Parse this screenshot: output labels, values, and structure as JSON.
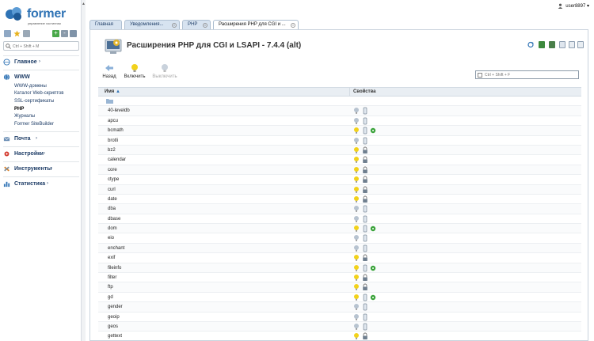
{
  "brand": {
    "name": "former",
    "subtitle": "управление хостингом"
  },
  "user": {
    "name": "user8897"
  },
  "sidebar": {
    "search_placeholder": "Ctrl + Shift + M",
    "groups": [
      {
        "label": "Главное"
      },
      {
        "label": "WWW"
      },
      {
        "label": "Почта"
      },
      {
        "label": "Настройки"
      },
      {
        "label": "Инструменты"
      },
      {
        "label": "Статистика"
      }
    ],
    "www_items": [
      "WWW-домены",
      "Каталог Web-скриптов",
      "SSL-сертификаты",
      "PHP",
      "Журналы",
      "Former SiteBuilder"
    ]
  },
  "tabs": [
    {
      "label": "Главная"
    },
    {
      "label": "Уведомления..."
    },
    {
      "label": "PHP"
    },
    {
      "label": "Расширения PHP для CGI и ..."
    }
  ],
  "page": {
    "title": "Расширения PHP для CGI и LSAPI - 7.4.4 (alt)"
  },
  "toolbar": {
    "back": "Назад",
    "enable": "Включить",
    "disable": "Выключить"
  },
  "filter": {
    "placeholder": "Ctrl + Shift + F"
  },
  "table": {
    "col_name": "Имя",
    "col_props": "Свойства",
    "rows": [
      {
        "name": "40-leveldb",
        "on": false,
        "lock": false,
        "ext": false
      },
      {
        "name": "apcu",
        "on": false,
        "lock": false,
        "ext": false
      },
      {
        "name": "bcmath",
        "on": true,
        "lock": false,
        "ext": true
      },
      {
        "name": "brotli",
        "on": false,
        "lock": false,
        "ext": false
      },
      {
        "name": "bz2",
        "on": true,
        "lock": true,
        "ext": false
      },
      {
        "name": "calendar",
        "on": true,
        "lock": true,
        "ext": false
      },
      {
        "name": "core",
        "on": true,
        "lock": true,
        "ext": false
      },
      {
        "name": "ctype",
        "on": true,
        "lock": true,
        "ext": false
      },
      {
        "name": "curl",
        "on": true,
        "lock": true,
        "ext": false
      },
      {
        "name": "date",
        "on": true,
        "lock": true,
        "ext": false
      },
      {
        "name": "dba",
        "on": false,
        "lock": false,
        "ext": false
      },
      {
        "name": "dbase",
        "on": false,
        "lock": false,
        "ext": false
      },
      {
        "name": "dom",
        "on": true,
        "lock": false,
        "ext": true
      },
      {
        "name": "eio",
        "on": false,
        "lock": false,
        "ext": false
      },
      {
        "name": "enchant",
        "on": false,
        "lock": false,
        "ext": false
      },
      {
        "name": "exif",
        "on": true,
        "lock": true,
        "ext": false
      },
      {
        "name": "fileinfo",
        "on": true,
        "lock": false,
        "ext": true
      },
      {
        "name": "filter",
        "on": true,
        "lock": true,
        "ext": false
      },
      {
        "name": "ftp",
        "on": true,
        "lock": true,
        "ext": false
      },
      {
        "name": "gd",
        "on": true,
        "lock": false,
        "ext": true
      },
      {
        "name": "gender",
        "on": false,
        "lock": false,
        "ext": false
      },
      {
        "name": "geoip",
        "on": false,
        "lock": false,
        "ext": false
      },
      {
        "name": "geos",
        "on": false,
        "lock": false,
        "ext": false
      },
      {
        "name": "gettext",
        "on": true,
        "lock": true,
        "ext": false
      }
    ]
  },
  "colors": {
    "accent": "#2f73b5",
    "nav_text": "#1d3c66",
    "bulb_on": "#f2d21b",
    "bulb_off": "#b7c3d0",
    "ext_green": "#3aa33a"
  }
}
